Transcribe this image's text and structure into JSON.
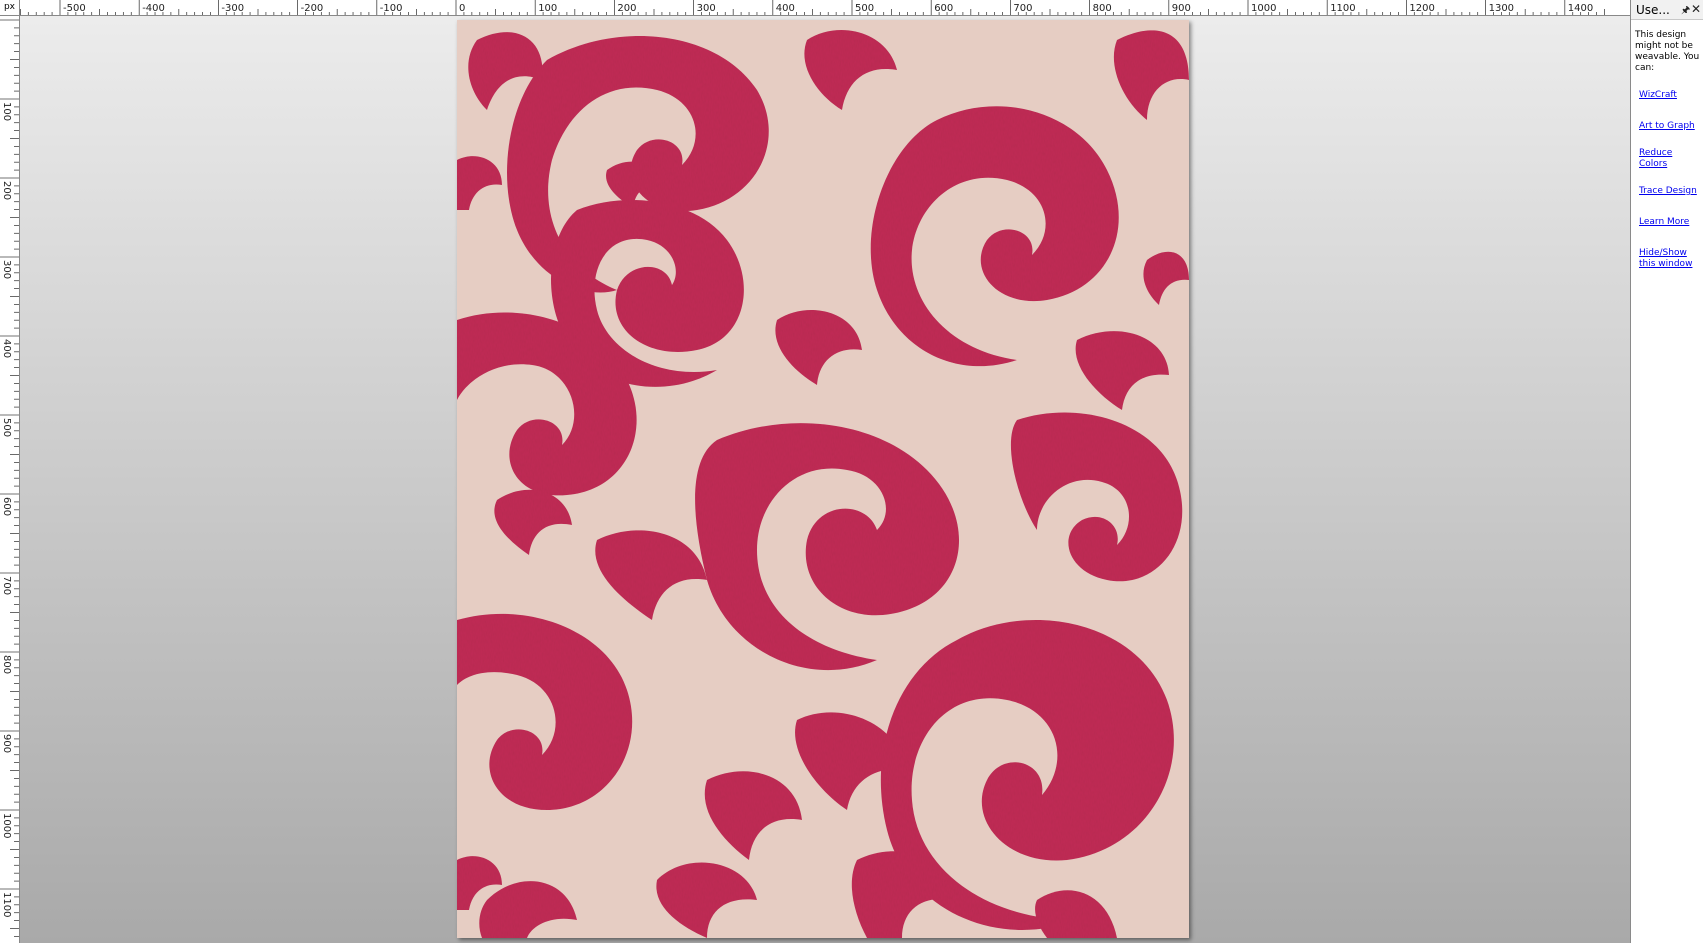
{
  "ruler": {
    "unit_label": "px",
    "top_labels": [
      "-500",
      "-400",
      "-300",
      "-200",
      "-100",
      "0",
      "100",
      "200",
      "300",
      "400",
      "500",
      "600",
      "700",
      "800",
      "900",
      "1000",
      "1100",
      "1200",
      "1300",
      "1400"
    ],
    "left_labels": [
      "100",
      "200",
      "300",
      "400",
      "500",
      "600",
      "700",
      "800",
      "900",
      "1000",
      "1100"
    ]
  },
  "canvas": {
    "gradient_top": "#ececec",
    "gradient_bottom": "#a9a9a9"
  },
  "design": {
    "pattern": "damask scroll rug",
    "colors": {
      "background": "#e6cdc3",
      "motif": "#c02c55"
    }
  },
  "panel": {
    "title": "Use...",
    "pin_icon": "pin-icon",
    "close_icon": "close-icon",
    "message": "This design might not be weavable. You can:",
    "links": {
      "wizcraft": "WizCraft",
      "art_to_graph": "Art to Graph",
      "reduce_colors": "Reduce Colors",
      "trace_design": "Trace Design",
      "learn_more": "Learn More",
      "hide_show": "Hide/Show this window"
    }
  }
}
